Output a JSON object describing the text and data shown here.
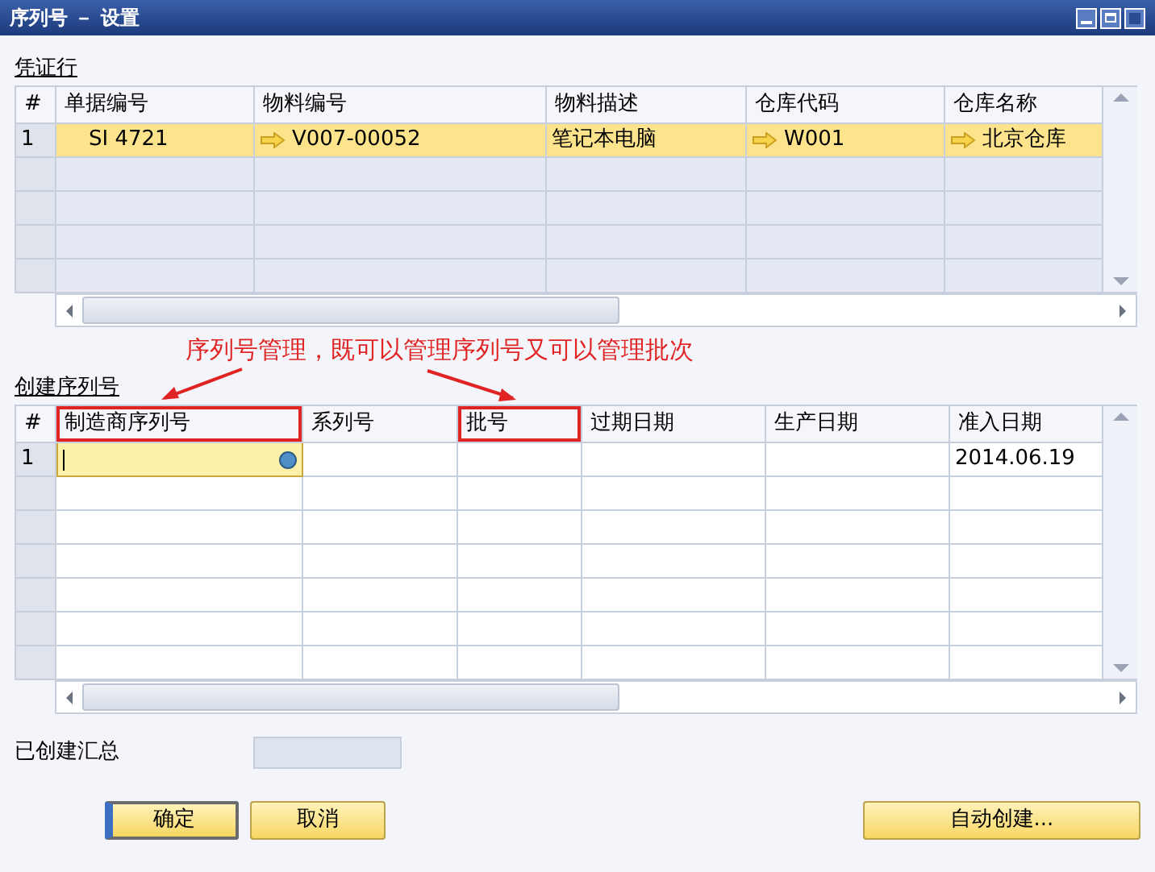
{
  "window": {
    "title": "序列号 － 设置"
  },
  "document_lines": {
    "label": "凭证行",
    "columns": [
      {
        "label": "#"
      },
      {
        "label": "单据编号"
      },
      {
        "label": "物料编号"
      },
      {
        "label": "物料描述"
      },
      {
        "label": "仓库代码"
      },
      {
        "label": "仓库名称"
      }
    ],
    "rows": [
      {
        "selected": true,
        "cells": [
          {
            "text": "1"
          },
          {
            "text": "SI 4721"
          },
          {
            "text": "V007-00052",
            "link": true
          },
          {
            "text": "笔记本电脑"
          },
          {
            "text": "W001",
            "link": true
          },
          {
            "text": "北京仓库",
            "link": true
          }
        ]
      }
    ]
  },
  "annotation": {
    "text": "序列号管理，既可以管理序列号又可以管理批次"
  },
  "create_serials": {
    "label": "创建序列号",
    "columns": [
      {
        "label": "#",
        "highlighted": false
      },
      {
        "label": "制造商序列号",
        "highlighted": true
      },
      {
        "label": "系列号",
        "highlighted": false
      },
      {
        "label": "批号",
        "highlighted": true
      },
      {
        "label": "过期日期",
        "highlighted": false
      },
      {
        "label": "生产日期",
        "highlighted": false
      },
      {
        "label": "准入日期",
        "highlighted": false
      }
    ],
    "rows": [
      {
        "cells": [
          {
            "text": "1"
          },
          {
            "text": "",
            "active": true
          },
          {
            "text": ""
          },
          {
            "text": ""
          },
          {
            "text": ""
          },
          {
            "text": ""
          },
          {
            "text": "2014.06.19"
          }
        ]
      }
    ]
  },
  "total": {
    "label": "已创建汇总"
  },
  "buttons": [
    {
      "label": "确定",
      "default": true
    },
    {
      "label": "取消",
      "default": false
    },
    {
      "label": "自动创建...",
      "default": false
    }
  ]
}
